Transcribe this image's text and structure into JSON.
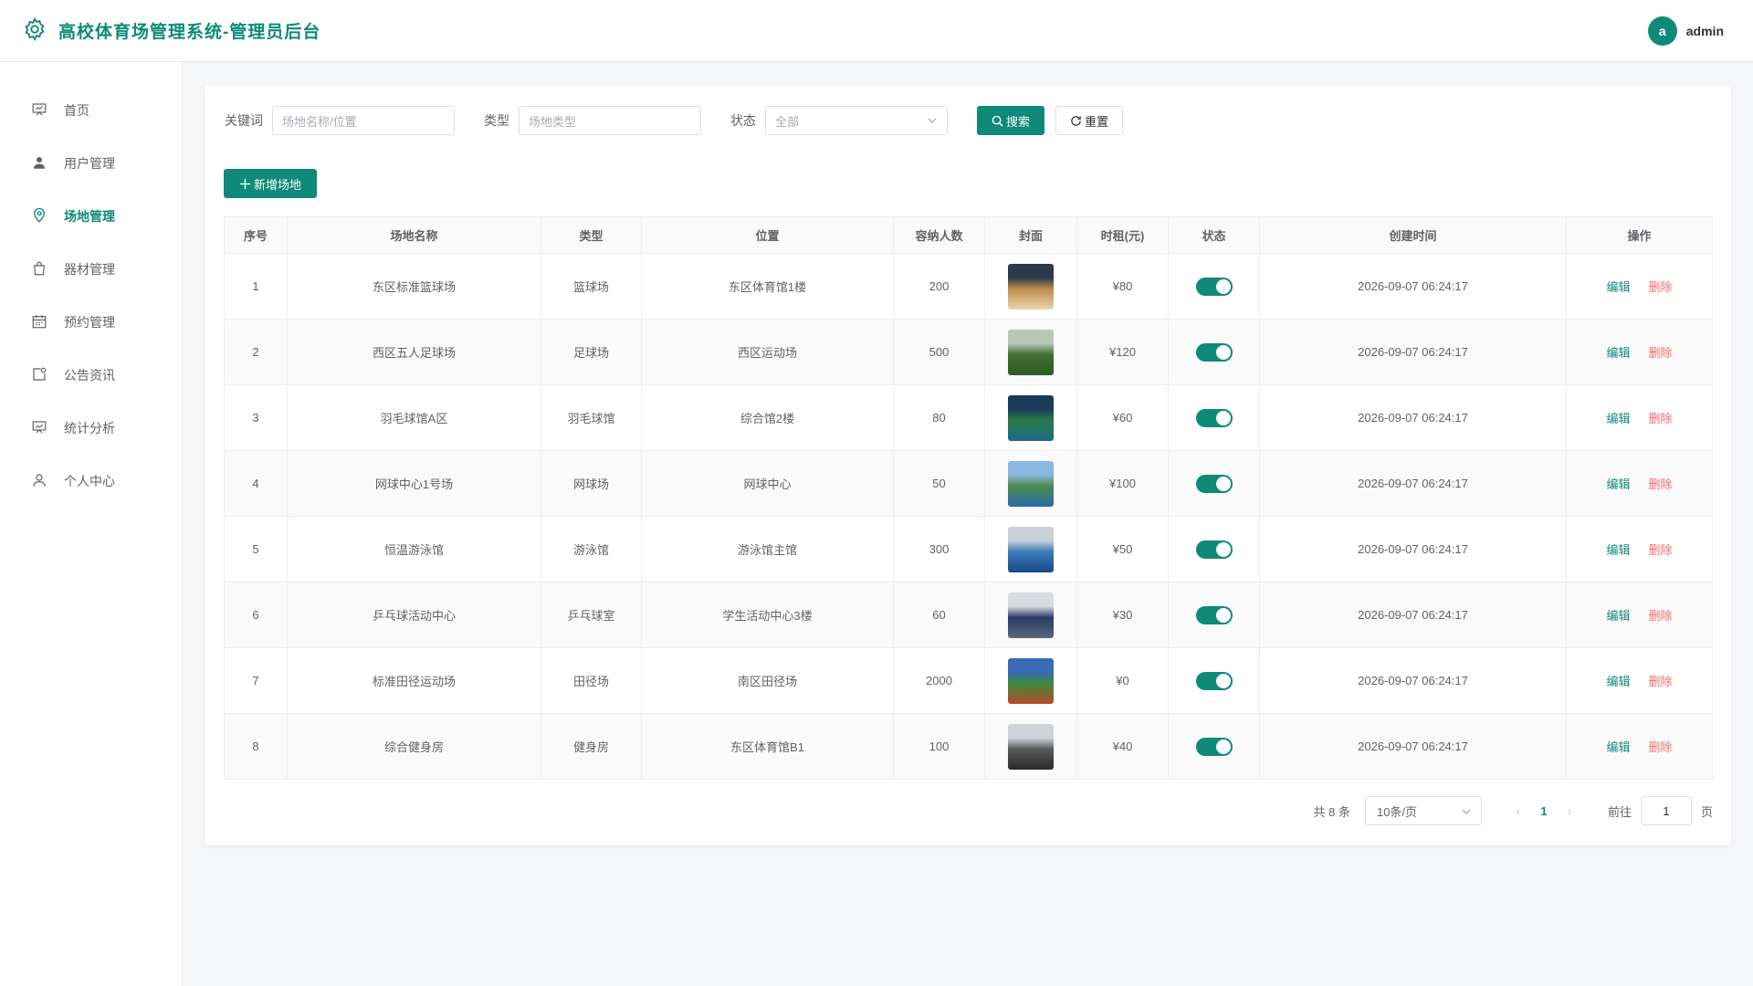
{
  "header": {
    "title": "高校体育场管理系统-管理员后台",
    "avatar_letter": "a",
    "username": "admin"
  },
  "sidebar": {
    "items": [
      {
        "label": "首页",
        "icon": "presentation-icon",
        "active": false
      },
      {
        "label": "用户管理",
        "icon": "user-icon",
        "active": false
      },
      {
        "label": "场地管理",
        "icon": "location-pin-icon",
        "active": true
      },
      {
        "label": "器材管理",
        "icon": "shopping-bag-icon",
        "active": false
      },
      {
        "label": "预约管理",
        "icon": "calendar-icon",
        "active": false
      },
      {
        "label": "公告资讯",
        "icon": "notice-icon",
        "active": false
      },
      {
        "label": "统计分析",
        "icon": "chart-board-icon",
        "active": false
      },
      {
        "label": "个人中心",
        "icon": "person-icon",
        "active": false
      }
    ]
  },
  "filters": {
    "keyword_label": "关键词",
    "keyword_placeholder": "场地名称/位置",
    "type_label": "类型",
    "type_placeholder": "场地类型",
    "status_label": "状态",
    "status_value": "全部",
    "search_label": "搜索",
    "reset_label": "重置"
  },
  "add_button": "新增场地",
  "table": {
    "headers": [
      "序号",
      "场地名称",
      "类型",
      "位置",
      "容纳人数",
      "封面",
      "时租(元)",
      "状态",
      "创建时间",
      "操作"
    ],
    "rows": [
      {
        "index": "1",
        "name": "东区标准篮球场",
        "type": "篮球场",
        "location": "东区体育馆1楼",
        "capacity": "200",
        "price": "¥80",
        "enabled": true,
        "created": "2026-09-07 06:24:17",
        "edit": "编辑",
        "delete": "删除",
        "cover_colors": [
          "#2b3a4a",
          "#c08a4a",
          "#e8d8b0"
        ]
      },
      {
        "index": "2",
        "name": "西区五人足球场",
        "type": "足球场",
        "location": "西区运动场",
        "capacity": "500",
        "price": "¥120",
        "enabled": true,
        "created": "2026-09-07 06:24:17",
        "edit": "编辑",
        "delete": "删除",
        "cover_colors": [
          "#b8c8b8",
          "#3f6e32",
          "#2e5a26"
        ]
      },
      {
        "index": "3",
        "name": "羽毛球馆A区",
        "type": "羽毛球馆",
        "location": "综合馆2楼",
        "capacity": "80",
        "price": "¥60",
        "enabled": true,
        "created": "2026-09-07 06:24:17",
        "edit": "编辑",
        "delete": "删除",
        "cover_colors": [
          "#1c3a5a",
          "#2a7a4a",
          "#1e6a8a"
        ]
      },
      {
        "index": "4",
        "name": "网球中心1号场",
        "type": "网球场",
        "location": "网球中心",
        "capacity": "50",
        "price": "¥100",
        "enabled": true,
        "created": "2026-09-07 06:24:17",
        "edit": "编辑",
        "delete": "删除",
        "cover_colors": [
          "#8ab8e0",
          "#4a8a4a",
          "#2a6ab0"
        ]
      },
      {
        "index": "5",
        "name": "恒温游泳馆",
        "type": "游泳馆",
        "location": "游泳馆主馆",
        "capacity": "300",
        "price": "¥50",
        "enabled": true,
        "created": "2026-09-07 06:24:17",
        "edit": "编辑",
        "delete": "删除",
        "cover_colors": [
          "#c8d0d8",
          "#3a7ab8",
          "#1a4a8a"
        ]
      },
      {
        "index": "6",
        "name": "乒乓球活动中心",
        "type": "乒乓球室",
        "location": "学生活动中心3楼",
        "capacity": "60",
        "price": "¥30",
        "enabled": true,
        "created": "2026-09-07 06:24:17",
        "edit": "编辑",
        "delete": "删除",
        "cover_colors": [
          "#d8dce0",
          "#2a3a6a",
          "#5a6a7a"
        ]
      },
      {
        "index": "7",
        "name": "标准田径运动场",
        "type": "田径场",
        "location": "南区田径场",
        "capacity": "2000",
        "price": "¥0",
        "enabled": true,
        "created": "2026-09-07 06:24:17",
        "edit": "编辑",
        "delete": "删除",
        "cover_colors": [
          "#3a6ab8",
          "#3a8a3a",
          "#b84a2a"
        ]
      },
      {
        "index": "8",
        "name": "综合健身房",
        "type": "健身房",
        "location": "东区体育馆B1",
        "capacity": "100",
        "price": "¥40",
        "enabled": true,
        "created": "2026-09-07 06:24:17",
        "edit": "编辑",
        "delete": "删除",
        "cover_colors": [
          "#d0d4d8",
          "#5a5a5a",
          "#2a2a2a"
        ]
      }
    ]
  },
  "pagination": {
    "total": "共 8 条",
    "page_size": "10条/页",
    "current_page": "1",
    "goto_label": "前往",
    "goto_value": "1",
    "page_suffix": "页"
  },
  "colors": {
    "primary": "#0f8a78",
    "danger": "#f56c6c"
  }
}
